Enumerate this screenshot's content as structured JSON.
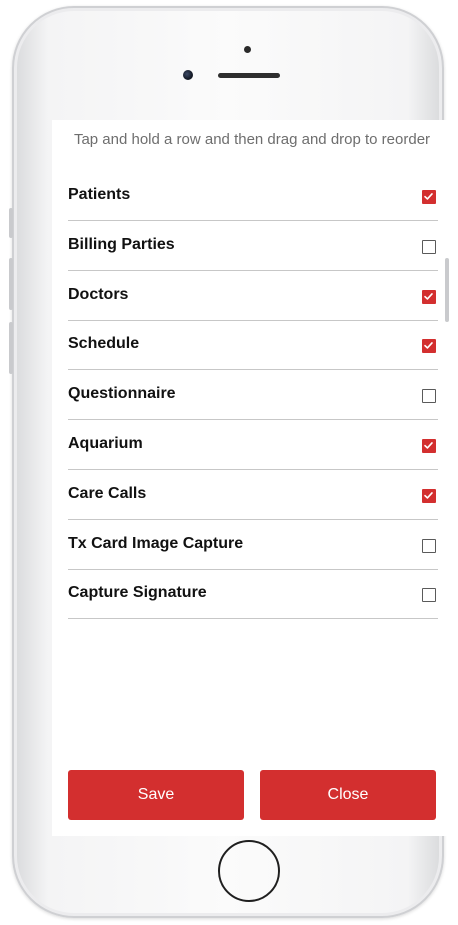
{
  "instruction": "Tap and hold a row and then drag and drop to reorder",
  "items": [
    {
      "label": "Patients",
      "checked": true
    },
    {
      "label": "Billing Parties",
      "checked": false
    },
    {
      "label": "Doctors",
      "checked": true
    },
    {
      "label": "Schedule",
      "checked": true
    },
    {
      "label": "Questionnaire",
      "checked": false
    },
    {
      "label": "Aquarium",
      "checked": true
    },
    {
      "label": "Care Calls",
      "checked": true
    },
    {
      "label": "Tx Card Image Capture",
      "checked": false
    },
    {
      "label": "Capture Signature",
      "checked": false
    }
  ],
  "buttons": {
    "save_label": "Save",
    "close_label": "Close"
  },
  "colors": {
    "accent": "#d32f2f",
    "divider": "#c7c7c7",
    "instruction_text": "#6e6e6e"
  },
  "icons": {
    "checked": "checkbox-checked-icon",
    "unchecked": "checkbox-unchecked-icon"
  }
}
